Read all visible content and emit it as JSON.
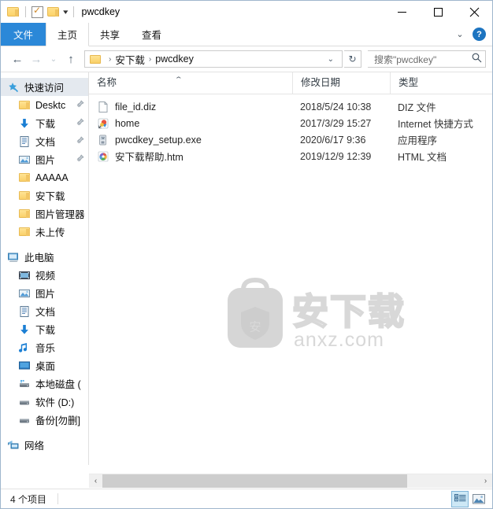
{
  "window": {
    "title": "pwcdkey",
    "quick_access_toolbar": [
      {
        "name": "folder-properties-icon",
        "label": ""
      },
      {
        "name": "properties-icon",
        "label": ""
      },
      {
        "name": "new-folder-icon",
        "label": ""
      },
      {
        "name": "customize-chevron-icon",
        "label": "▾"
      }
    ],
    "controls": {
      "minimize": "—",
      "maximize": "□",
      "close": "✕"
    }
  },
  "ribbon": {
    "tabs": [
      {
        "label": "文件",
        "active": false,
        "style": "file"
      },
      {
        "label": "主页",
        "active": true,
        "style": "normal"
      },
      {
        "label": "共享",
        "active": false,
        "style": "normal"
      },
      {
        "label": "查看",
        "active": false,
        "style": "normal"
      }
    ],
    "collapse_label": "⌄",
    "help_label": "?"
  },
  "addressbar": {
    "back_label": "←",
    "forward_label": "→",
    "recent_label": "⌄",
    "up_label": "↑",
    "breadcrumbs": [
      "安下载",
      "pwcdkey"
    ],
    "breadcrumb_separator": "›",
    "dropdown_label": "⌄",
    "refresh_label": "↻"
  },
  "search": {
    "placeholder": "搜索\"pwcdkey\"",
    "icon": "search-icon"
  },
  "sidebar": {
    "groups": [
      {
        "header": {
          "label": "快速访问",
          "icon": "star-pin-icon",
          "selected": true
        },
        "items": [
          {
            "label": "Desktc",
            "icon": "folder-icon",
            "pinned": true
          },
          {
            "label": "下载",
            "icon": "downloads-icon",
            "pinned": true
          },
          {
            "label": "文档",
            "icon": "documents-icon",
            "pinned": true
          },
          {
            "label": "图片",
            "icon": "pictures-icon",
            "pinned": true
          },
          {
            "label": "AAAAA",
            "icon": "folder-icon",
            "pinned": false
          },
          {
            "label": "安下载",
            "icon": "folder-icon",
            "pinned": false
          },
          {
            "label": "图片管理器",
            "icon": "folder-icon",
            "pinned": false
          },
          {
            "label": "未上传",
            "icon": "folder-icon",
            "pinned": false
          }
        ]
      },
      {
        "header": {
          "label": "此电脑",
          "icon": "this-pc-icon",
          "selected": false
        },
        "items": [
          {
            "label": "视频",
            "icon": "videos-icon",
            "pinned": false
          },
          {
            "label": "图片",
            "icon": "pictures-icon",
            "pinned": false
          },
          {
            "label": "文档",
            "icon": "documents-icon",
            "pinned": false
          },
          {
            "label": "下载",
            "icon": "downloads-icon",
            "pinned": false
          },
          {
            "label": "音乐",
            "icon": "music-icon",
            "pinned": false
          },
          {
            "label": "桌面",
            "icon": "desktop-icon",
            "pinned": false
          },
          {
            "label": "本地磁盘 (",
            "icon": "local-disk-icon",
            "pinned": false
          },
          {
            "label": "软件 (D:)",
            "icon": "drive-icon",
            "pinned": false
          },
          {
            "label": "备份[勿删]",
            "icon": "drive-icon",
            "pinned": false
          }
        ]
      },
      {
        "header": {
          "label": "网络",
          "icon": "network-icon",
          "selected": false
        },
        "items": []
      }
    ]
  },
  "filelist": {
    "columns": [
      {
        "label": "名称",
        "sorted": true,
        "sort_direction": "ascending"
      },
      {
        "label": "修改日期",
        "sorted": false
      },
      {
        "label": "类型",
        "sorted": false
      }
    ],
    "sort_indicator": "⌃",
    "rows": [
      {
        "name": "file_id.diz",
        "icon": "generic-file-icon",
        "date": "2018/5/24 10:38",
        "type": "DIZ 文件"
      },
      {
        "name": "home",
        "icon": "internet-shortcut-icon",
        "date": "2017/3/29 15:27",
        "type": "Internet 快捷方式"
      },
      {
        "name": "pwcdkey_setup.exe",
        "icon": "application-icon",
        "date": "2020/6/17 9:36",
        "type": "应用程序"
      },
      {
        "name": "安下载帮助.htm",
        "icon": "html-document-icon",
        "date": "2019/12/9 12:39",
        "type": "HTML 文档"
      }
    ]
  },
  "watermark": {
    "text_cn": "安下载",
    "text_url": "anxz.com",
    "badge_char": "安",
    "color": "#d8d8d8"
  },
  "scrollbar": {
    "left_arrow": "‹",
    "right_arrow": "›"
  },
  "statusbar": {
    "item_count": "4 个项目",
    "views": [
      {
        "name": "details-view-button",
        "active": true
      },
      {
        "name": "large-icons-view-button",
        "active": false
      }
    ]
  },
  "colors": {
    "accent": "#2b88d8",
    "window_border": "#9fb6cd",
    "selection": "#e4e9ef",
    "watermark": "#d8d8d8"
  }
}
